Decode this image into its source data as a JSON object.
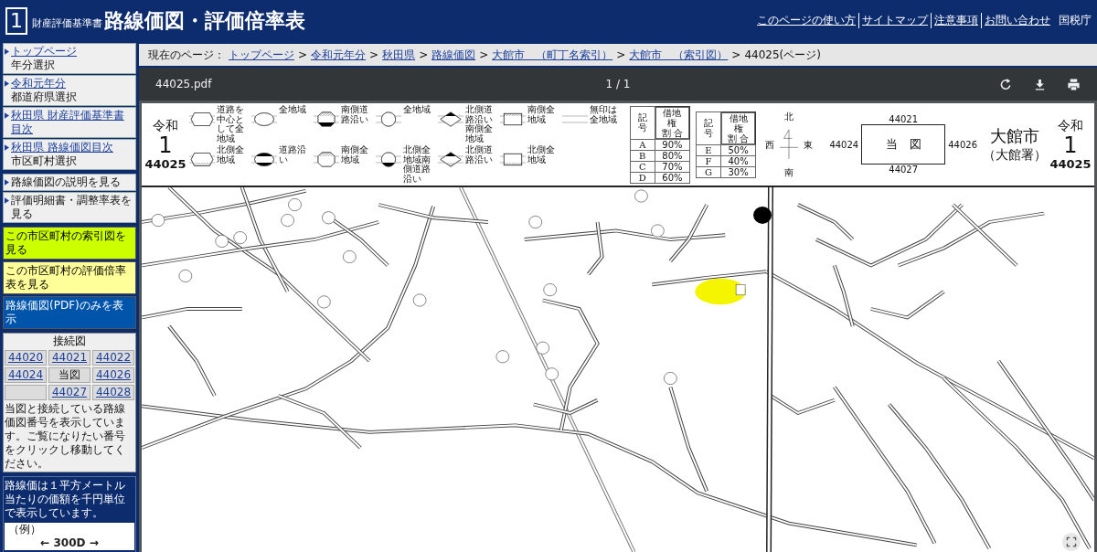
{
  "header": {
    "logo": "1",
    "subtitle": "財産評価基準書",
    "title": "路線価図・評価倍率表",
    "links": [
      "このページの使い方",
      "サイトマップ",
      "注意事項",
      "お問い合わせ"
    ],
    "agency": "国税庁"
  },
  "sidebar": {
    "nav_groups": [
      [
        {
          "kind": "link",
          "label": "トップページ",
          "sub": "年分選択"
        },
        {
          "kind": "link",
          "label": "令和元年分",
          "sub": "都道府県選択"
        },
        {
          "kind": "link",
          "label": "秋田県 財産評価基準書目次"
        },
        {
          "kind": "link",
          "label": "秋田県 路線価図目次",
          "sub": "市区町村選択"
        }
      ],
      [
        {
          "kind": "plain",
          "label": "路線価図の説明を見る"
        },
        {
          "kind": "plain",
          "label": "評価明細書・調整率表を見る"
        }
      ]
    ],
    "actions": [
      {
        "label": "この市区町村の索引図を見る",
        "color": "#ccff00"
      },
      {
        "label": "この市区町村の評価倍率表を見る",
        "color": "#ffff99"
      },
      {
        "label": "路線価図(PDF)のみを表示",
        "color": "#0055aa"
      }
    ],
    "connection": {
      "title": "接続図",
      "cells": [
        {
          "kind": "link",
          "label": "44020"
        },
        {
          "kind": "link",
          "label": "44021"
        },
        {
          "kind": "link",
          "label": "44022"
        },
        {
          "kind": "link",
          "label": "44024"
        },
        {
          "kind": "current",
          "label": "当図"
        },
        {
          "kind": "link",
          "label": "44026"
        },
        {
          "kind": "empty"
        },
        {
          "kind": "link",
          "label": "44027"
        },
        {
          "kind": "link",
          "label": "44028"
        }
      ],
      "note": "当図と接続している路線価図番号を表示しています。ご覧になりたい番号をクリックし移動してください。"
    },
    "unit_note": {
      "text": "路線価は１平方メートル当たりの価額を千円単位で表示しています。",
      "example_label": "（例）",
      "example_value": "← 300D →"
    }
  },
  "breadcrumb": {
    "prefix": "現在のページ：",
    "separator": ">",
    "links": [
      "トップページ",
      "令和元年分",
      "秋田県",
      "路線価図",
      "大館市　（町丁名索引）",
      "大館市　（索引図）"
    ],
    "current": "44025(ページ)"
  },
  "viewer": {
    "filename": "44025.pdf",
    "page_indicator": "1 / 1"
  },
  "sheet": {
    "left_id": {
      "era": "令和",
      "year": "1",
      "number": "44025"
    },
    "legend": [
      {
        "kind": "hexagon-none-none",
        "label": "道路を中心として全地域"
      },
      {
        "kind": "ellipse-none-none",
        "label": "全地域"
      },
      {
        "kind": "octagon-hatch-black",
        "label": "南側道路沿い"
      },
      {
        "kind": "circle-none-none",
        "label": "全地域"
      },
      {
        "kind": "diamond-black-none",
        "label": "北側道路沿い南側全地域"
      },
      {
        "kind": "rect-hatch-none",
        "label": "南側全地域"
      },
      {
        "kind": "lines-none-none",
        "label": "無印は全地域"
      },
      {
        "kind": "hexagon-none-hatch",
        "label": "北側全地域"
      },
      {
        "kind": "ellipse-black-black",
        "label": "道路沿い"
      },
      {
        "kind": "octagon-hatch-none",
        "label": "南側全地域"
      },
      {
        "kind": "circle-none-black",
        "label": "北側全地域南側道路沿い"
      },
      {
        "kind": "diamond-black-hatch",
        "label": "北側道路沿い"
      },
      {
        "kind": "rect-none-hatch",
        "label": "北側全地域"
      }
    ],
    "lease_tables": [
      {
        "symbol_header": "記号",
        "ratio_header": [
          "借地権",
          "割 合"
        ],
        "rows": [
          {
            "symbol": "A",
            "ratio": "90%"
          },
          {
            "symbol": "B",
            "ratio": "80%"
          },
          {
            "symbol": "C",
            "ratio": "70%"
          },
          {
            "symbol": "D",
            "ratio": "60%"
          }
        ]
      },
      {
        "symbol_header": "記号",
        "ratio_header": [
          "借地権",
          "割 合"
        ],
        "rows": [
          {
            "symbol": "E",
            "ratio": "50%"
          },
          {
            "symbol": "F",
            "ratio": "40%"
          },
          {
            "symbol": "G",
            "ratio": "30%"
          }
        ]
      }
    ],
    "compass": {
      "north": "北",
      "west": "西",
      "east": "東",
      "south": "南"
    },
    "index_map": {
      "north": "44021",
      "west": "44024",
      "center": "当　図",
      "east": "44026",
      "south": "44027"
    },
    "city": "大館市",
    "office": "（大館署）",
    "right_id": {
      "era": "令和",
      "year": "1",
      "number": "44025"
    }
  }
}
